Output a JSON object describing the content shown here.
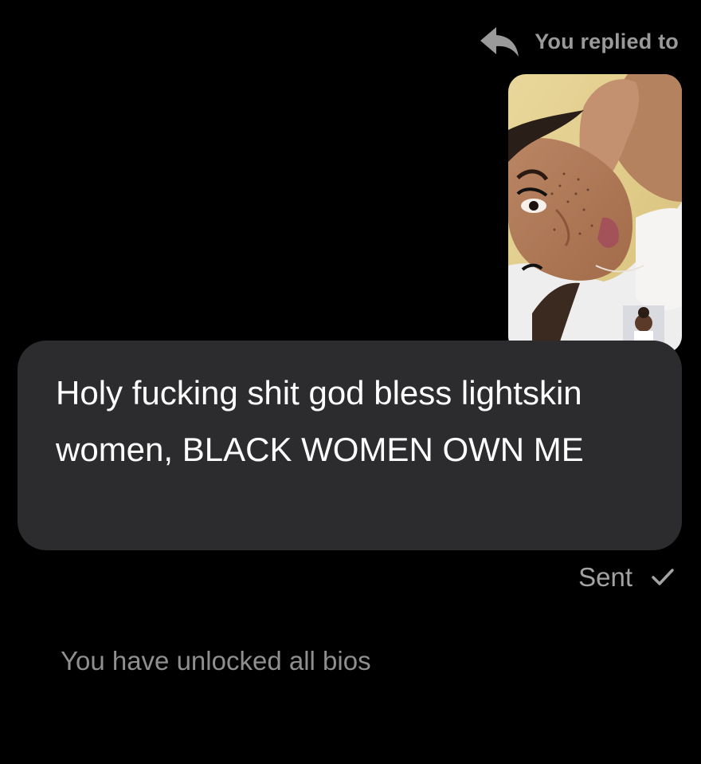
{
  "reply_header": {
    "label": "You replied to",
    "icon": "reply-arrow-icon"
  },
  "replied_story": {
    "kind": "photo-thumbnail",
    "inset": "avatar-thumbnail"
  },
  "message": {
    "text": "Holy fucking shit god bless lightskin women, BLACK WOMEN OWN ME"
  },
  "status": {
    "label": "Sent",
    "icon": "checkmark-icon"
  },
  "system_note": {
    "text": "You have unlocked all bios"
  },
  "colors": {
    "background": "#000000",
    "bubble": "#2c2c2e",
    "message_text": "#ffffff",
    "muted_text": "#9a9a9a"
  }
}
